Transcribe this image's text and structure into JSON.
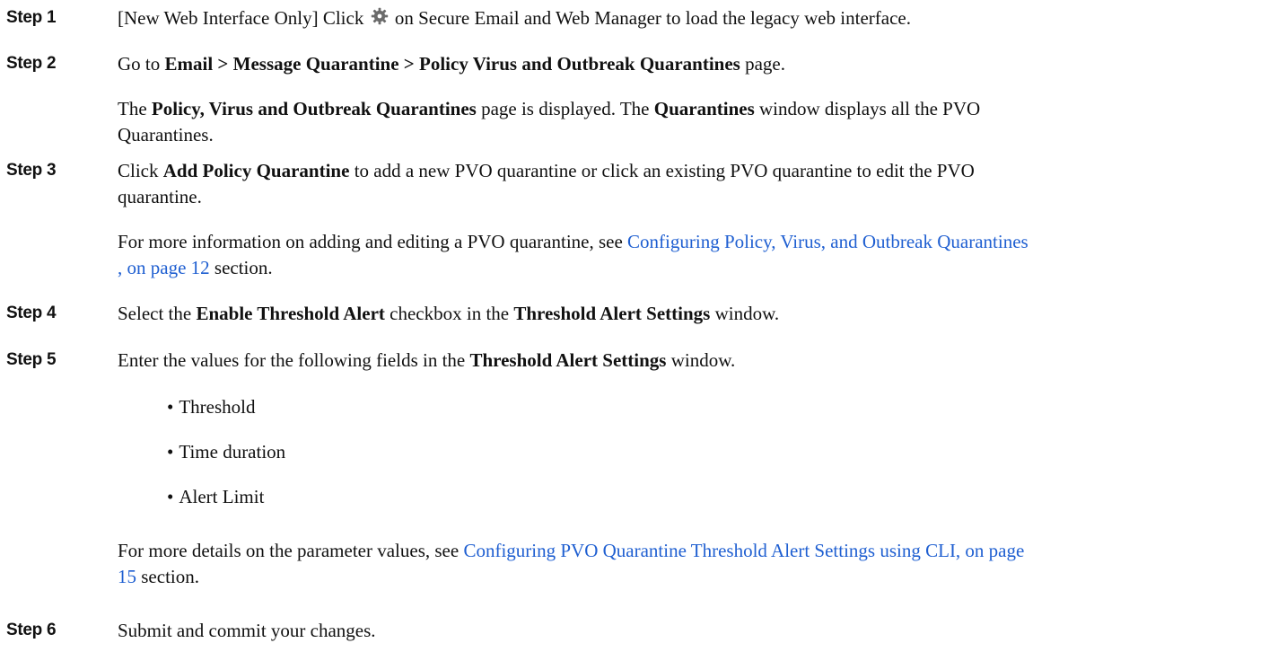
{
  "steps": [
    {
      "label": "Step 1",
      "text_before_icon": "[New Web Interface Only] Click",
      "icon": "gear-icon",
      "text_after_icon": "on Secure Email and Web Manager to load the legacy web interface."
    },
    {
      "label": "Step 2",
      "line1_pre": "Go to",
      "line1_bold": "Email > Message Quarantine > Policy Virus and Outbreak Quarantines",
      "line1_post": "page.",
      "para_bold1": "Policy, Virus and Outbreak Quarantines",
      "para_mid": "page is displayed. The",
      "para_bold2": "Quarantines",
      "para_end1": "window displays all the PVO",
      "para_end2": "Quarantines."
    },
    {
      "label": "Step 3",
      "pre": "Click",
      "bold": "Add Policy Quarantine",
      "post1": "to add a new PVO quarantine or click an existing PVO quarantine to edit the PVO",
      "post2": "quarantine.",
      "more_pre": "For more information on adding and editing a PVO quarantine, see",
      "more_link1": "Configuring Policy, Virus, and Outbreak Quarantines",
      "more_link2": ", on page 12",
      "more_post": "section."
    },
    {
      "label": "Step 4",
      "pre": "Select the",
      "bold1": "Enable Threshold Alert",
      "mid": "checkbox in the",
      "bold2": "Threshold Alert Settings",
      "post": "window."
    },
    {
      "label": "Step 5",
      "pre": "Enter the values for the following fields in the",
      "bold": "Threshold Alert Settings",
      "post": "window.",
      "bullet": "•",
      "fields": [
        "Threshold",
        "Time duration",
        "Alert Limit"
      ],
      "more_pre": "For more details on the parameter values, see",
      "more_link1": "Configuring PVO Quarantine Threshold Alert Settings using CLI, on page",
      "more_link2": "15",
      "more_post": "section."
    },
    {
      "label": "Step 6",
      "text": "Submit and commit your changes."
    }
  ],
  "colors": {
    "link": "#1f5fd1",
    "text": "#111111"
  }
}
